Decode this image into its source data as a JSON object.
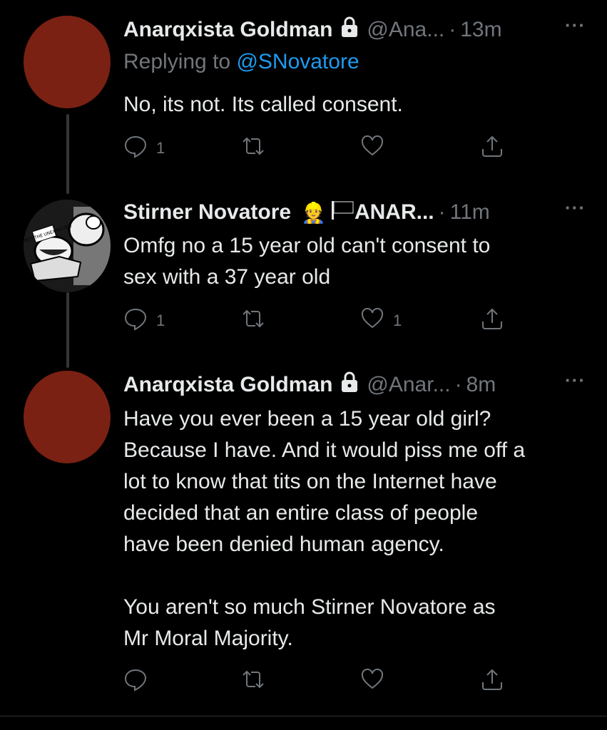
{
  "tweets": [
    {
      "name": "Anarqxista Goldman",
      "handle": "@Ana...",
      "time": "13m",
      "reply_prefix": "Replying to ",
      "reply_mention": "@SNovatore",
      "text": "No, its not. Its called consent.",
      "reply_count": "1",
      "retweet_count": "",
      "like_count": ""
    },
    {
      "name": "Stirner Novatore",
      "name_emoji": "👷",
      "flag_icon": "black-flag-icon",
      "name_suffix": "ANAR...",
      "time": "11m",
      "text": "Omfg no a 15 year old can't consent to\nsex with a 37 year old",
      "reply_count": "1",
      "retweet_count": "",
      "like_count": "1"
    },
    {
      "name": "Anarqxista Goldman",
      "handle": "@Anar...",
      "time": "8m",
      "text": "Have you ever been a 15 year old girl?\nBecause I have. And it would piss me off a\nlot to know that tits on the Internet have\ndecided that an entire class of people\nhave been denied human agency.\n\nYou aren't so much Stirner Novatore as\nMr Moral Majority.",
      "reply_count": "",
      "retweet_count": "",
      "like_count": ""
    }
  ],
  "ui": {
    "dot": "·",
    "more": "···",
    "avatar_badge": "EXPECT THE UNEXPECTED"
  },
  "colors": {
    "background": "#000000",
    "avatar_red": "#7a2113",
    "link_blue": "#1d9bf0",
    "muted_gray": "#71767b"
  }
}
